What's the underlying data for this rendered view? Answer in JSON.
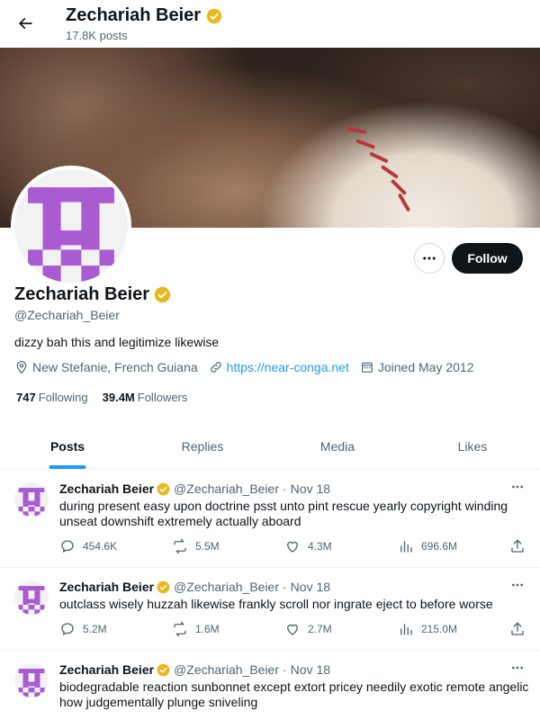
{
  "header": {
    "name": "Zechariah Beier",
    "posts_count": "17.8K posts",
    "back_icon": "arrow-left-icon"
  },
  "profile": {
    "name": "Zechariah Beier",
    "handle": "@Zechariah_Beier",
    "bio": "dizzy bah this and legitimize likewise",
    "location": "New Stefanie, French Guiana",
    "website": "https://near-conga.net",
    "joined": "Joined May 2012",
    "following_count": "747",
    "following_label": "Following",
    "followers_count": "39.4M",
    "followers_label": "Followers",
    "follow_button": "Follow",
    "verified_color": "#e8b81e",
    "avatar_color": "#a95bd1"
  },
  "tabs": [
    {
      "label": "Posts",
      "active": true
    },
    {
      "label": "Replies",
      "active": false
    },
    {
      "label": "Media",
      "active": false
    },
    {
      "label": "Likes",
      "active": false
    }
  ],
  "tweets": [
    {
      "name": "Zechariah Beier",
      "handle": "@Zechariah_Beier",
      "date": "Nov 18",
      "text": "during present easy upon doctrine psst unto pint rescue yearly copyright winding unseat downshift extremely actually aboard",
      "replies": "454.6K",
      "reposts": "5.5M",
      "likes": "4.3M",
      "views": "696.6M"
    },
    {
      "name": "Zechariah Beier",
      "handle": "@Zechariah_Beier",
      "date": "Nov 18",
      "text": "outclass wisely huzzah likewise frankly scroll nor ingrate eject to before worse",
      "replies": "5.2M",
      "reposts": "1.6M",
      "likes": "2.7M",
      "views": "215.0M"
    },
    {
      "name": "Zechariah Beier",
      "handle": "@Zechariah_Beier",
      "date": "Nov 18",
      "text": "biodegradable reaction sunbonnet except extort pricey needily exotic remote angelic how judgementally plunge sniveling",
      "replies": "",
      "reposts": "",
      "likes": "",
      "views": ""
    }
  ],
  "colors": {
    "accent": "#1d9bf0",
    "text": "#0f1419",
    "muted": "#536471",
    "border": "#eff3f4"
  }
}
